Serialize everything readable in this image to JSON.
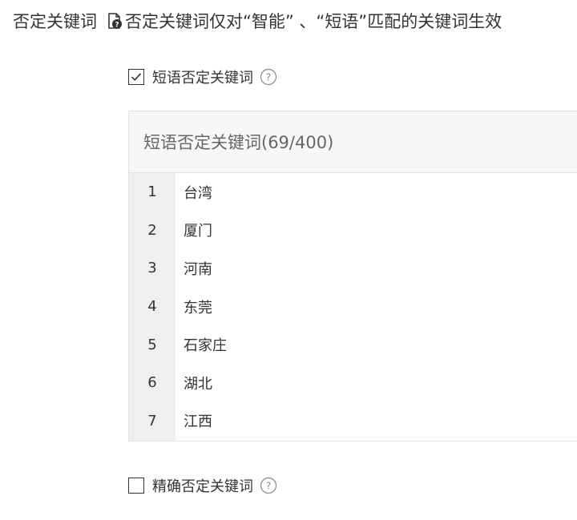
{
  "header": {
    "title": "否定关键词",
    "note": "否定关键词仅对“智能” 、“短语”匹配的关键词生效"
  },
  "phrase_option": {
    "label": "短语否定关键词",
    "checked": true
  },
  "phrase_panel": {
    "title": "短语否定关键词(69/400)",
    "rows": [
      {
        "num": "1",
        "text": "台湾"
      },
      {
        "num": "2",
        "text": "厦门"
      },
      {
        "num": "3",
        "text": "河南"
      },
      {
        "num": "4",
        "text": "东莞"
      },
      {
        "num": "5",
        "text": "石家庄"
      },
      {
        "num": "6",
        "text": "湖北"
      },
      {
        "num": "7",
        "text": "江西"
      }
    ]
  },
  "exact_option": {
    "label": "精确否定关键词",
    "checked": false
  },
  "icons": {
    "doc": "document-question-icon",
    "help": "question-circle-icon",
    "check": "checkmark-icon"
  }
}
